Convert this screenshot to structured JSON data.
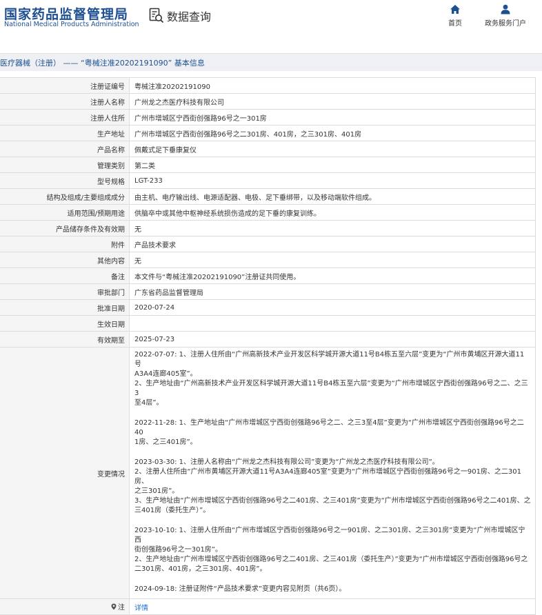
{
  "header": {
    "logo_cn": "国家药品监督管理局",
    "logo_en": "National Medical Products Administration",
    "query_label": "数据查询",
    "nav": [
      {
        "label": "首页",
        "icon": "home-icon"
      },
      {
        "label": "政务服务门户",
        "icon": "user-icon"
      }
    ],
    "accent_color": "#1d4f91"
  },
  "breadcrumb": "医疗器械（注册） —— “粤械注准20202191090” 基本信息",
  "fields": [
    {
      "key": "注册证编号",
      "value": "粤械注准20202191090"
    },
    {
      "key": "注册人名称",
      "value": "广州龙之杰医疗科技有限公司"
    },
    {
      "key": "注册人住所",
      "value": "广州市增城区宁西街创强路96号之一301房"
    },
    {
      "key": "生产地址",
      "value": "广州市增城区宁西街创强路96号之二301房、401房，之三301房、401房"
    },
    {
      "key": "产品名称",
      "value": "佩戴式足下垂康复仪"
    },
    {
      "key": "管理类别",
      "value": "第二类"
    },
    {
      "key": "型号规格",
      "value": "LGT-233"
    },
    {
      "key": "结构及组成/主要组成成分",
      "value": "由主机、电疗输出线、电源适配器、电极、足下垂绑带，以及移动端软件组成。"
    },
    {
      "key": "适用范围/预期用途",
      "value": "供脑卒中或其他中枢神经系统损伤造成的足下垂的康复训练。"
    },
    {
      "key": "产品储存条件及有效期",
      "value": "无"
    },
    {
      "key": "附件",
      "value": "产品技术要求"
    },
    {
      "key": "其他内容",
      "value": "无"
    },
    {
      "key": "备注",
      "value": "本文件与“粤械注准20202191090”注册证共同使用。"
    },
    {
      "key": "审批部门",
      "value": "广东省药品监督管理局"
    },
    {
      "key": "批准日期",
      "value": "2020-07-24"
    },
    {
      "key": "生效日期",
      "value": ""
    },
    {
      "key": "有效期至",
      "value": "2025-07-23"
    }
  ],
  "changes": {
    "key": "变更情况",
    "blocks": [
      [
        "2022-07-07: 1、注册人住所由“广州高新技术产业开发区科学城开源大道11号B4栋五至六层”变更为“广州市黄埔区开源大道11号",
        "A3A4连廊405室”。",
        "2、生产地址由“广州高新技术产业开发区科学城开源大道11号B4栋五至六层”变更为“广州市增城区宁西街创强路96号之二、之三3",
        "至4层”。"
      ],
      [
        "2022-11-28: 1、生产地址由“广州市增城区宁西街创强路96号之二、之三3至4层”变更为“广州市增城区宁西街创强路96号之二40",
        "1房、之三401房”。"
      ],
      [
        "2023-03-30: 1、注册人名称由“广州龙之杰科技有限公司”变更为“广州龙之杰医疗科技有限公司”。",
        "2、注册人住所由“广州市黄埔区开源大道11号A3A4连廊405室”变更为“广州市增城区宁西街创强路96号之一901房、之二301房、",
        "之三301房”。",
        "3、生产地址由“广州市增城区宁西街创强路96号之二401房、之三401房”变更为“广州市增城区宁西街创强路96号之二401房、之",
        "三401房（委托生产）”。"
      ],
      [
        "2023-10-10: 1、注册人住所由“广州市增城区宁西街创强路96号之一901房、之二301房、之三301房”变更为“广州市增城区宁西",
        "街创强路96号之一301房”。",
        "2、生产地址由“广州市增城区宁西街创强路96号之二401房、之三401房（委托生产）”变更为“广州市增城区宁西街创强路96号之",
        "二301房、401房，之三301房、401房”。"
      ],
      [
        "2024-09-18: 注册证附件“产品技术要求”变更内容见附页（共6页）。"
      ]
    ]
  },
  "note": {
    "key": "注",
    "link": "详情"
  }
}
